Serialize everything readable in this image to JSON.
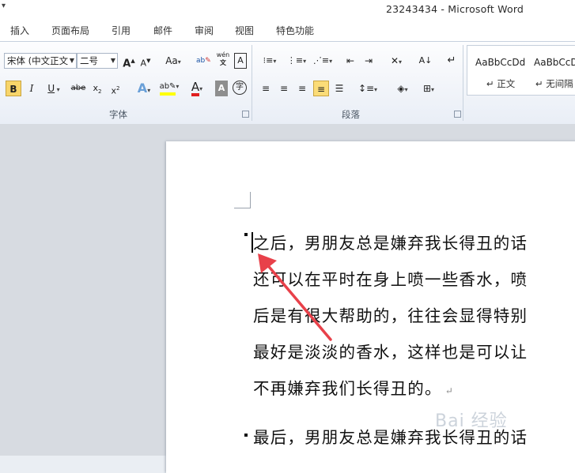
{
  "window": {
    "title": "23243434 - Microsoft Word"
  },
  "tabs": [
    "插入",
    "页面布局",
    "引用",
    "邮件",
    "审阅",
    "视图",
    "特色功能"
  ],
  "font_group": {
    "font_name": "宋体 (中文正文",
    "font_size": "二号",
    "label": "字体"
  },
  "paragraph_group": {
    "label": "段落"
  },
  "styles": [
    {
      "sample": "AaBbCcDd",
      "name": "↵ 正文"
    },
    {
      "sample": "AaBbCcDd",
      "name": "↵ 无间隔"
    }
  ],
  "document": {
    "paragraphs": [
      {
        "lines": [
          "之后，男朋友总是嫌弃我长得丑的话",
          "还可以在平时在身上喷一些香水，喷",
          "后是有很大帮助的，往往会显得特别",
          "最好是淡淡的香水，这样也是可以让",
          "不再嫌弃我们长得丑的。"
        ]
      },
      {
        "lines": [
          "最后，男朋友总是嫌弃我长得丑的话"
        ]
      }
    ],
    "return_mark": "↵"
  },
  "watermark": "Bai 经验",
  "colors": {
    "accent_arrow": "#e8414a",
    "highlight": "#f8d56a",
    "font_color": "#e02020",
    "highlight_color": "#ffff00"
  }
}
